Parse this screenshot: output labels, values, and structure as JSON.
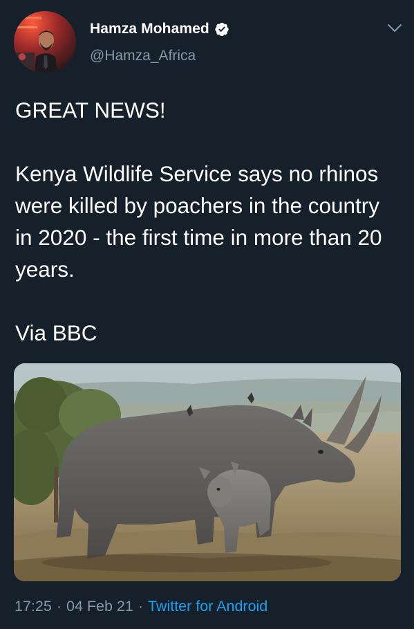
{
  "tweet": {
    "author": {
      "display_name": "Hamza Mohamed",
      "handle": "@Hamza_Africa",
      "verified": true,
      "avatar_icon": "user-avatar"
    },
    "text": "GREAT NEWS!\n\nKenya Wildlife Service says no rhinos were killed by poachers in the country in 2020 - the first time in more than 20 years.\n\nVia BBC",
    "media": {
      "kind": "photo"
    },
    "time": "17:25",
    "date": "04 Feb 21",
    "separator": "·",
    "source": "Twitter for Android"
  },
  "icons": {
    "verified": "verified-badge-icon",
    "menu": "chevron-down-icon"
  },
  "colors": {
    "background": "#15202b",
    "text": "#ffffff",
    "secondary_text": "#8899a6",
    "link": "#1da1f2"
  }
}
